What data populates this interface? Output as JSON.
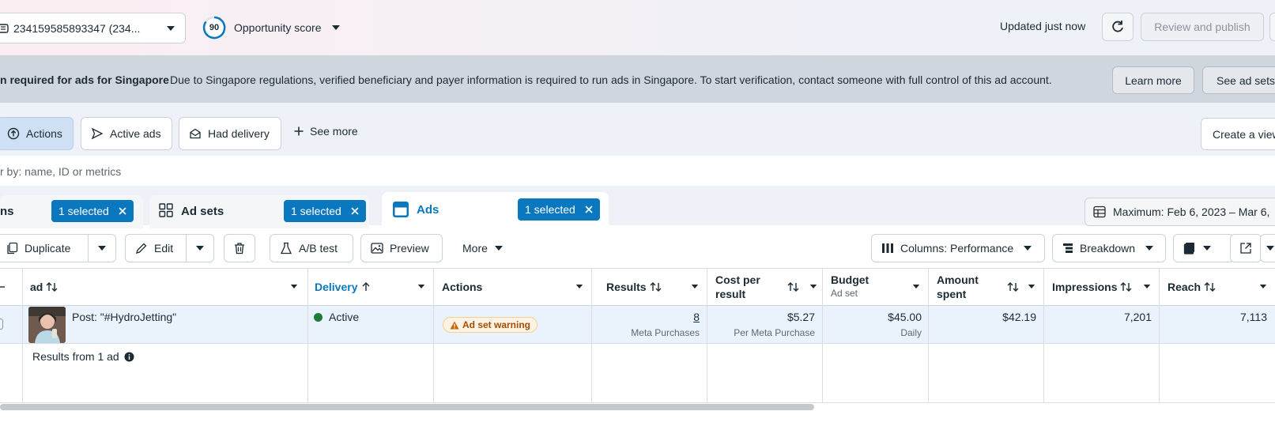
{
  "topbar": {
    "account_select": "234159585893347 (234...",
    "opportunity_score": "90",
    "opportunity_label": "Opportunity score",
    "updated_text": "Updated just now",
    "review_publish": "Review and publish"
  },
  "banner": {
    "title": "n required for ads for Singapore",
    "text": "Due to Singapore regulations, verified beneficiary and payer information is required to run ads in Singapore. To start verification, contact someone with full control of this ad account.",
    "learn_more": "Learn more",
    "see_ad_sets": "See ad sets"
  },
  "chips": {
    "actions": "Actions",
    "active_ads": "Active ads",
    "had_delivery": "Had delivery",
    "see_more": "See more",
    "create_view": "Create a view"
  },
  "search": {
    "placeholder": "r by: name, ID or metrics"
  },
  "tabs": {
    "campaigns": "ns",
    "ad_sets": "Ad sets",
    "ads": "Ads",
    "selected": "1 selected",
    "date_range": "Maximum: Feb 6, 2023 – Mar 6,"
  },
  "toolbar": {
    "duplicate": "Duplicate",
    "edit": "Edit",
    "ab_test": "A/B test",
    "preview": "Preview",
    "more": "More",
    "columns": "Columns: Performance",
    "breakdown": "Breakdown"
  },
  "table": {
    "headers": {
      "ad": "ad",
      "delivery": "Delivery",
      "actions": "Actions",
      "results": "Results",
      "cost_per_result_1": "Cost per",
      "cost_per_result_2": "result",
      "budget": "Budget",
      "budget_sub": "Ad set",
      "amount_spent_1": "Amount",
      "amount_spent_2": "spent",
      "impressions": "Impressions",
      "reach": "Reach"
    },
    "row": {
      "ad_name": "Post: \"#HydroJetting\"",
      "delivery": "Active",
      "actions_badge": "Ad set warning",
      "results": "8",
      "results_sub": "Meta Purchases",
      "cost_per_result": "$5.27",
      "cost_sub": "Per Meta Purchase",
      "budget": "$45.00",
      "budget_sub": "Daily",
      "amount_spent": "$42.19",
      "impressions": "7,201",
      "reach": "7,113"
    },
    "total_label": "Results from 1 ad"
  },
  "colors": {
    "accent": "#0a78be",
    "active_dot": "#1e7b3a",
    "warning": "#a34d00"
  }
}
